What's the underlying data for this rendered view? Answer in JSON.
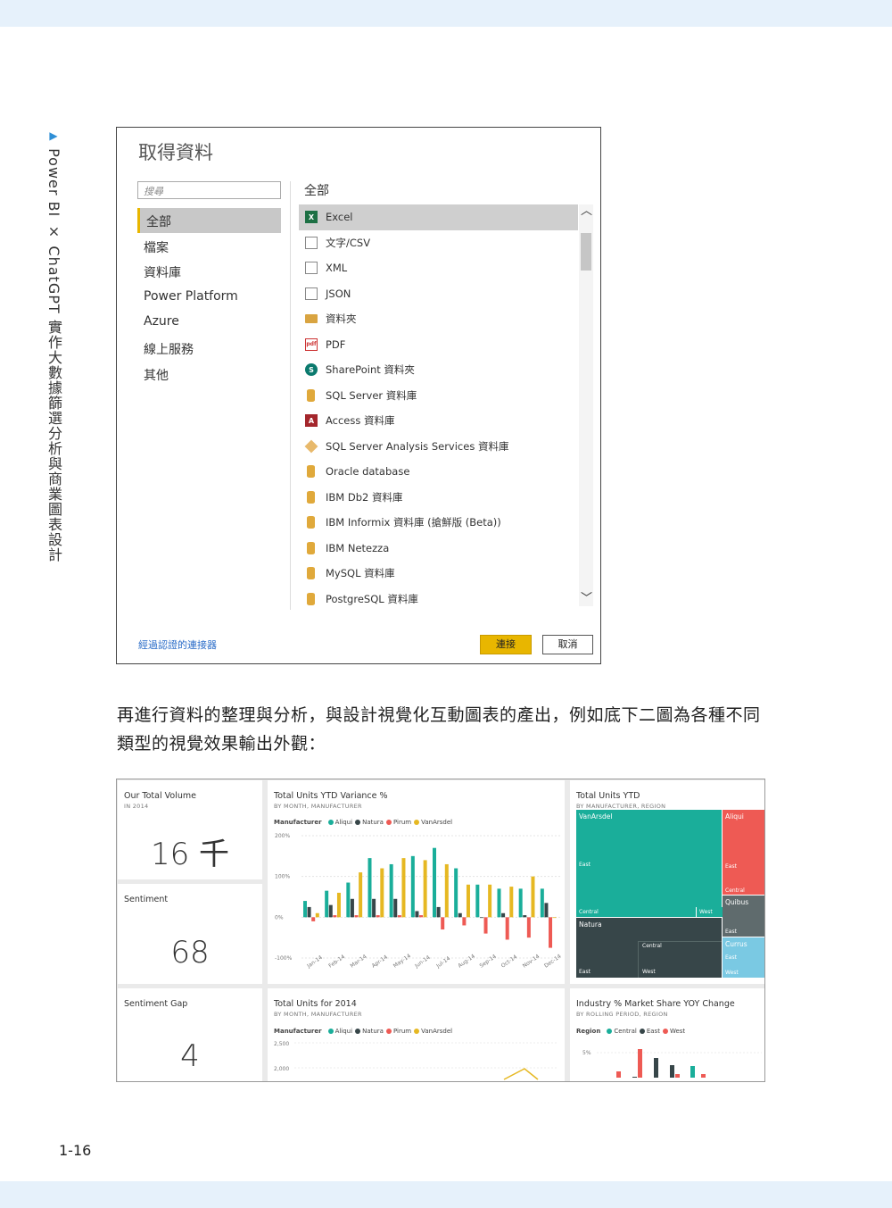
{
  "side_title": "Power BI × ChatGPT 實作大數據篩選分析與商業圖表設計",
  "page_number": "1-16",
  "dialog": {
    "title": "取得資料",
    "search_placeholder": "搜尋",
    "categories": [
      "全部",
      "檔案",
      "資料庫",
      "Power Platform",
      "Azure",
      "線上服務",
      "其他"
    ],
    "selected_category": "全部",
    "list_header": "全部",
    "items": [
      {
        "label": "Excel",
        "icon": "excel-icon"
      },
      {
        "label": "文字/CSV",
        "icon": "text-file-icon"
      },
      {
        "label": "XML",
        "icon": "xml-icon"
      },
      {
        "label": "JSON",
        "icon": "json-icon"
      },
      {
        "label": "資料夾",
        "icon": "folder-icon"
      },
      {
        "label": "PDF",
        "icon": "pdf-icon"
      },
      {
        "label": "SharePoint 資料夾",
        "icon": "sharepoint-icon"
      },
      {
        "label": "SQL Server 資料庫",
        "icon": "database-icon"
      },
      {
        "label": "Access 資料庫",
        "icon": "access-icon"
      },
      {
        "label": "SQL Server Analysis Services 資料庫",
        "icon": "cube-icon"
      },
      {
        "label": "Oracle database",
        "icon": "database-icon"
      },
      {
        "label": "IBM Db2 資料庫",
        "icon": "database-icon"
      },
      {
        "label": "IBM Informix 資料庫 (搶鮮版 (Beta))",
        "icon": "database-icon"
      },
      {
        "label": "IBM Netezza",
        "icon": "database-icon"
      },
      {
        "label": "MySQL 資料庫",
        "icon": "database-icon"
      },
      {
        "label": "PostgreSQL 資料庫",
        "icon": "database-icon"
      }
    ],
    "certified_link": "經過認證的連接器",
    "connect_label": "連接",
    "cancel_label": "取消"
  },
  "paragraph": "再進行資料的整理與分析，與設計視覺化互動圖表的產出，例如底下二圖為各種不同類型的視覺效果輸出外觀：",
  "dashboard": {
    "colors": {
      "aliqui": "#1aae9a",
      "natura": "#374649",
      "pirum": "#ee5a54",
      "vanarsdel": "#e6b822",
      "east": "#ee5a54",
      "central": "#1aae9a",
      "west": "#374649",
      "currus": "#7ac9e3",
      "quibus": "#5f6b6d"
    },
    "volume": {
      "title": "Our Total Volume",
      "subtitle": "IN 2014",
      "value": "16 千"
    },
    "sentiment": {
      "title": "Sentiment",
      "value": "68"
    },
    "sentiment_gap": {
      "title": "Sentiment Gap",
      "value": "4"
    },
    "variance": {
      "title": "Total Units YTD Variance %",
      "subtitle": "BY MONTH, MANUFACTURER",
      "legend_title": "Manufacturer",
      "legend": [
        "Aliqui",
        "Natura",
        "Pirum",
        "VanArsdel"
      ]
    },
    "treemap": {
      "title": "Total Units YTD",
      "subtitle": "BY MANUFACTURER, REGION",
      "labels": {
        "vanarsdel": "VanArsdel",
        "east": "East",
        "central": "Central",
        "west": "West",
        "natura": "Natura",
        "aliqui": "Aliqui",
        "quibus": "Quibus",
        "currus": "Currus"
      }
    },
    "units2014": {
      "title": "Total Units for 2014",
      "subtitle": "BY MONTH, MANUFACTURER",
      "legend_title": "Manufacturer",
      "legend": [
        "Aliqui",
        "Natura",
        "Pirum",
        "VanArsdel"
      ]
    },
    "industry": {
      "title": "Industry % Market Share YOY Change",
      "subtitle": "BY ROLLING PERIOD, REGION",
      "legend_title": "Region",
      "legend": [
        "Central",
        "East",
        "West"
      ]
    }
  },
  "chart_data": [
    {
      "type": "bar",
      "title": "Total Units YTD Variance %",
      "categories": [
        "Jan-14",
        "Feb-14",
        "Mar-14",
        "Apr-14",
        "May-14",
        "Jun-14",
        "Jul-14",
        "Aug-14",
        "Sep-14",
        "Oct-14",
        "Nov-14",
        "Dec-14"
      ],
      "yticks": [
        "200%",
        "100%",
        "0%",
        "-100%"
      ],
      "ylim": [
        -100,
        200
      ],
      "series": [
        {
          "name": "Aliqui",
          "values": [
            40,
            65,
            85,
            145,
            130,
            150,
            170,
            120,
            80,
            70,
            70,
            70
          ]
        },
        {
          "name": "Natura",
          "values": [
            25,
            30,
            45,
            45,
            45,
            15,
            25,
            10,
            0,
            10,
            5,
            35
          ]
        },
        {
          "name": "Pirum",
          "values": [
            -10,
            5,
            5,
            5,
            5,
            5,
            -30,
            -20,
            -40,
            -55,
            -50,
            -75
          ]
        },
        {
          "name": "VanArsdel",
          "values": [
            10,
            60,
            110,
            120,
            145,
            140,
            130,
            80,
            80,
            75,
            100,
            0
          ]
        }
      ]
    },
    {
      "type": "line",
      "title": "Total Units for 2014",
      "yticks": [
        "2,500",
        "2,000"
      ]
    },
    {
      "type": "bar",
      "title": "Industry % Market Share YOY Change",
      "yticks": [
        "5%"
      ]
    }
  ]
}
